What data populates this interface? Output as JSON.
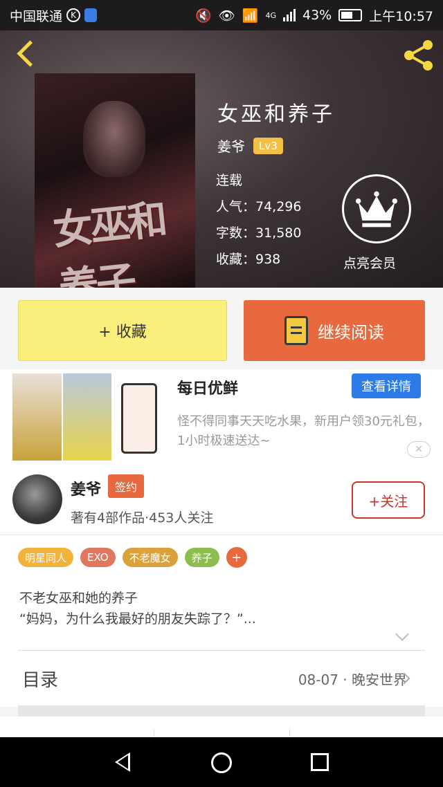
{
  "status_bar": {
    "carrier": "中国联通",
    "carrier_badge": "K",
    "network": "4G",
    "battery": "43%",
    "time": "上午10:57"
  },
  "book": {
    "title": "女巫和养子",
    "author": "姜爷",
    "level": "Lv3",
    "status": "连载",
    "popularity": "人气：74,296",
    "word_count": "字数：31,580",
    "favorites": "收藏：938",
    "vip_label": "点亮会员",
    "cover_art_text": "女巫和养子"
  },
  "actions": {
    "collect_label": "+ 收藏",
    "read_label": "继续阅读"
  },
  "ad": {
    "title": "每日优鲜",
    "button": "查看详情",
    "description": "怪不得同事天天吃水果，新用户领30元礼包，1小时极速送达~",
    "close": "✕"
  },
  "author_card": {
    "name": "姜爷",
    "badge": "签约",
    "stats": "著有4部作品·453人关注",
    "follow_label": "+关注"
  },
  "tags": [
    {
      "label": "明星同人",
      "color": "#f2b33d"
    },
    {
      "label": "EXO",
      "color": "#e07860"
    },
    {
      "label": "不老魔女",
      "color": "#d9a23a"
    },
    {
      "label": "养子",
      "color": "#8cbd4e"
    }
  ],
  "tag_add": "+",
  "description": {
    "line1": "不老女巫和她的养子",
    "line2": "“妈妈，为什么我最好的朋友失踪了？”..."
  },
  "toc": {
    "label": "目录",
    "latest": "08-07 · 晚安世界"
  },
  "colors": {
    "accent_orange": "#e8693e",
    "accent_yellow": "#f9ef7a",
    "ad_blue": "#2d7be6",
    "follow_red": "#c6352c",
    "back_yellow": "#f5d742"
  }
}
